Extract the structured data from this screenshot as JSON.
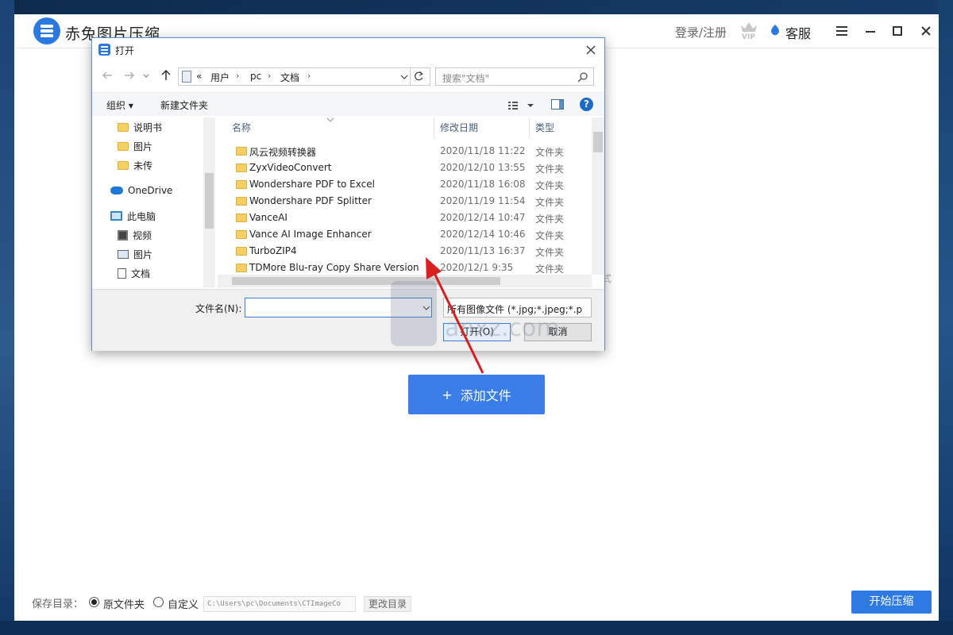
{
  "app": {
    "title": "赤兔图片压缩",
    "login_label": "登录/注册",
    "service_label": "客服",
    "add_file_label": "添加文件",
    "add_file_plus": "+",
    "ghost_text": "式",
    "save_dir_label": "保存目录：",
    "radio_original": "原文件夹",
    "radio_custom": "自定义",
    "save_path": "C:\\Users\\pc\\Documents\\CTImageCo",
    "change_dir_label": "更改目录",
    "start_label": "开始压缩"
  },
  "dialog": {
    "title": "打开",
    "address": {
      "prefix": "«",
      "segments": [
        "用户",
        "pc",
        "文档"
      ]
    },
    "search_placeholder": "搜索\"文档\"",
    "organize_label": "组织 ▾",
    "new_folder_label": "新建文件夹",
    "help_label": "?",
    "nav_items": [
      {
        "label": "说明书",
        "icon": "folder-icon"
      },
      {
        "label": "图片",
        "icon": "folder-icon"
      },
      {
        "label": "未传",
        "icon": "folder-icon"
      },
      {
        "label": "OneDrive",
        "icon": "onedrive-icon"
      },
      {
        "label": "此电脑",
        "icon": "this-pc-icon"
      },
      {
        "label": "视频",
        "icon": "videos-icon"
      },
      {
        "label": "图片",
        "icon": "pictures-icon"
      },
      {
        "label": "文档",
        "icon": "documents-icon"
      }
    ],
    "columns": {
      "name": "名称",
      "date": "修改日期",
      "type": "类型"
    },
    "rows": [
      {
        "name": "风云视频转换器",
        "date": "2020/11/18 11:22",
        "type": "文件夹"
      },
      {
        "name": "ZyxVideoConvert",
        "date": "2020/12/10 13:55",
        "type": "文件夹"
      },
      {
        "name": "Wondershare PDF to Excel",
        "date": "2020/11/18 16:08",
        "type": "文件夹"
      },
      {
        "name": "Wondershare PDF Splitter",
        "date": "2020/11/19 11:54",
        "type": "文件夹"
      },
      {
        "name": "VanceAI",
        "date": "2020/12/14 10:47",
        "type": "文件夹"
      },
      {
        "name": "Vance AI Image Enhancer",
        "date": "2020/12/14 10:46",
        "type": "文件夹"
      },
      {
        "name": "TurboZIP4",
        "date": "2020/11/13 16:37",
        "type": "文件夹"
      },
      {
        "name": "TDMore Blu-ray Copy Share Version",
        "date": "2020/12/1 9:35",
        "type": "文件夹"
      }
    ],
    "filename_label": "文件名(N):",
    "filename_value": "",
    "filter_value": "所有图像文件 (*.jpg;*.jpeg;*.p",
    "open_label": "打开(O)",
    "cancel_label": "取消"
  },
  "watermark": {
    "text": "anxz.com"
  },
  "colors": {
    "accent": "#3a7de8",
    "arrow": "#e02020",
    "folder": "#f5cf64"
  }
}
